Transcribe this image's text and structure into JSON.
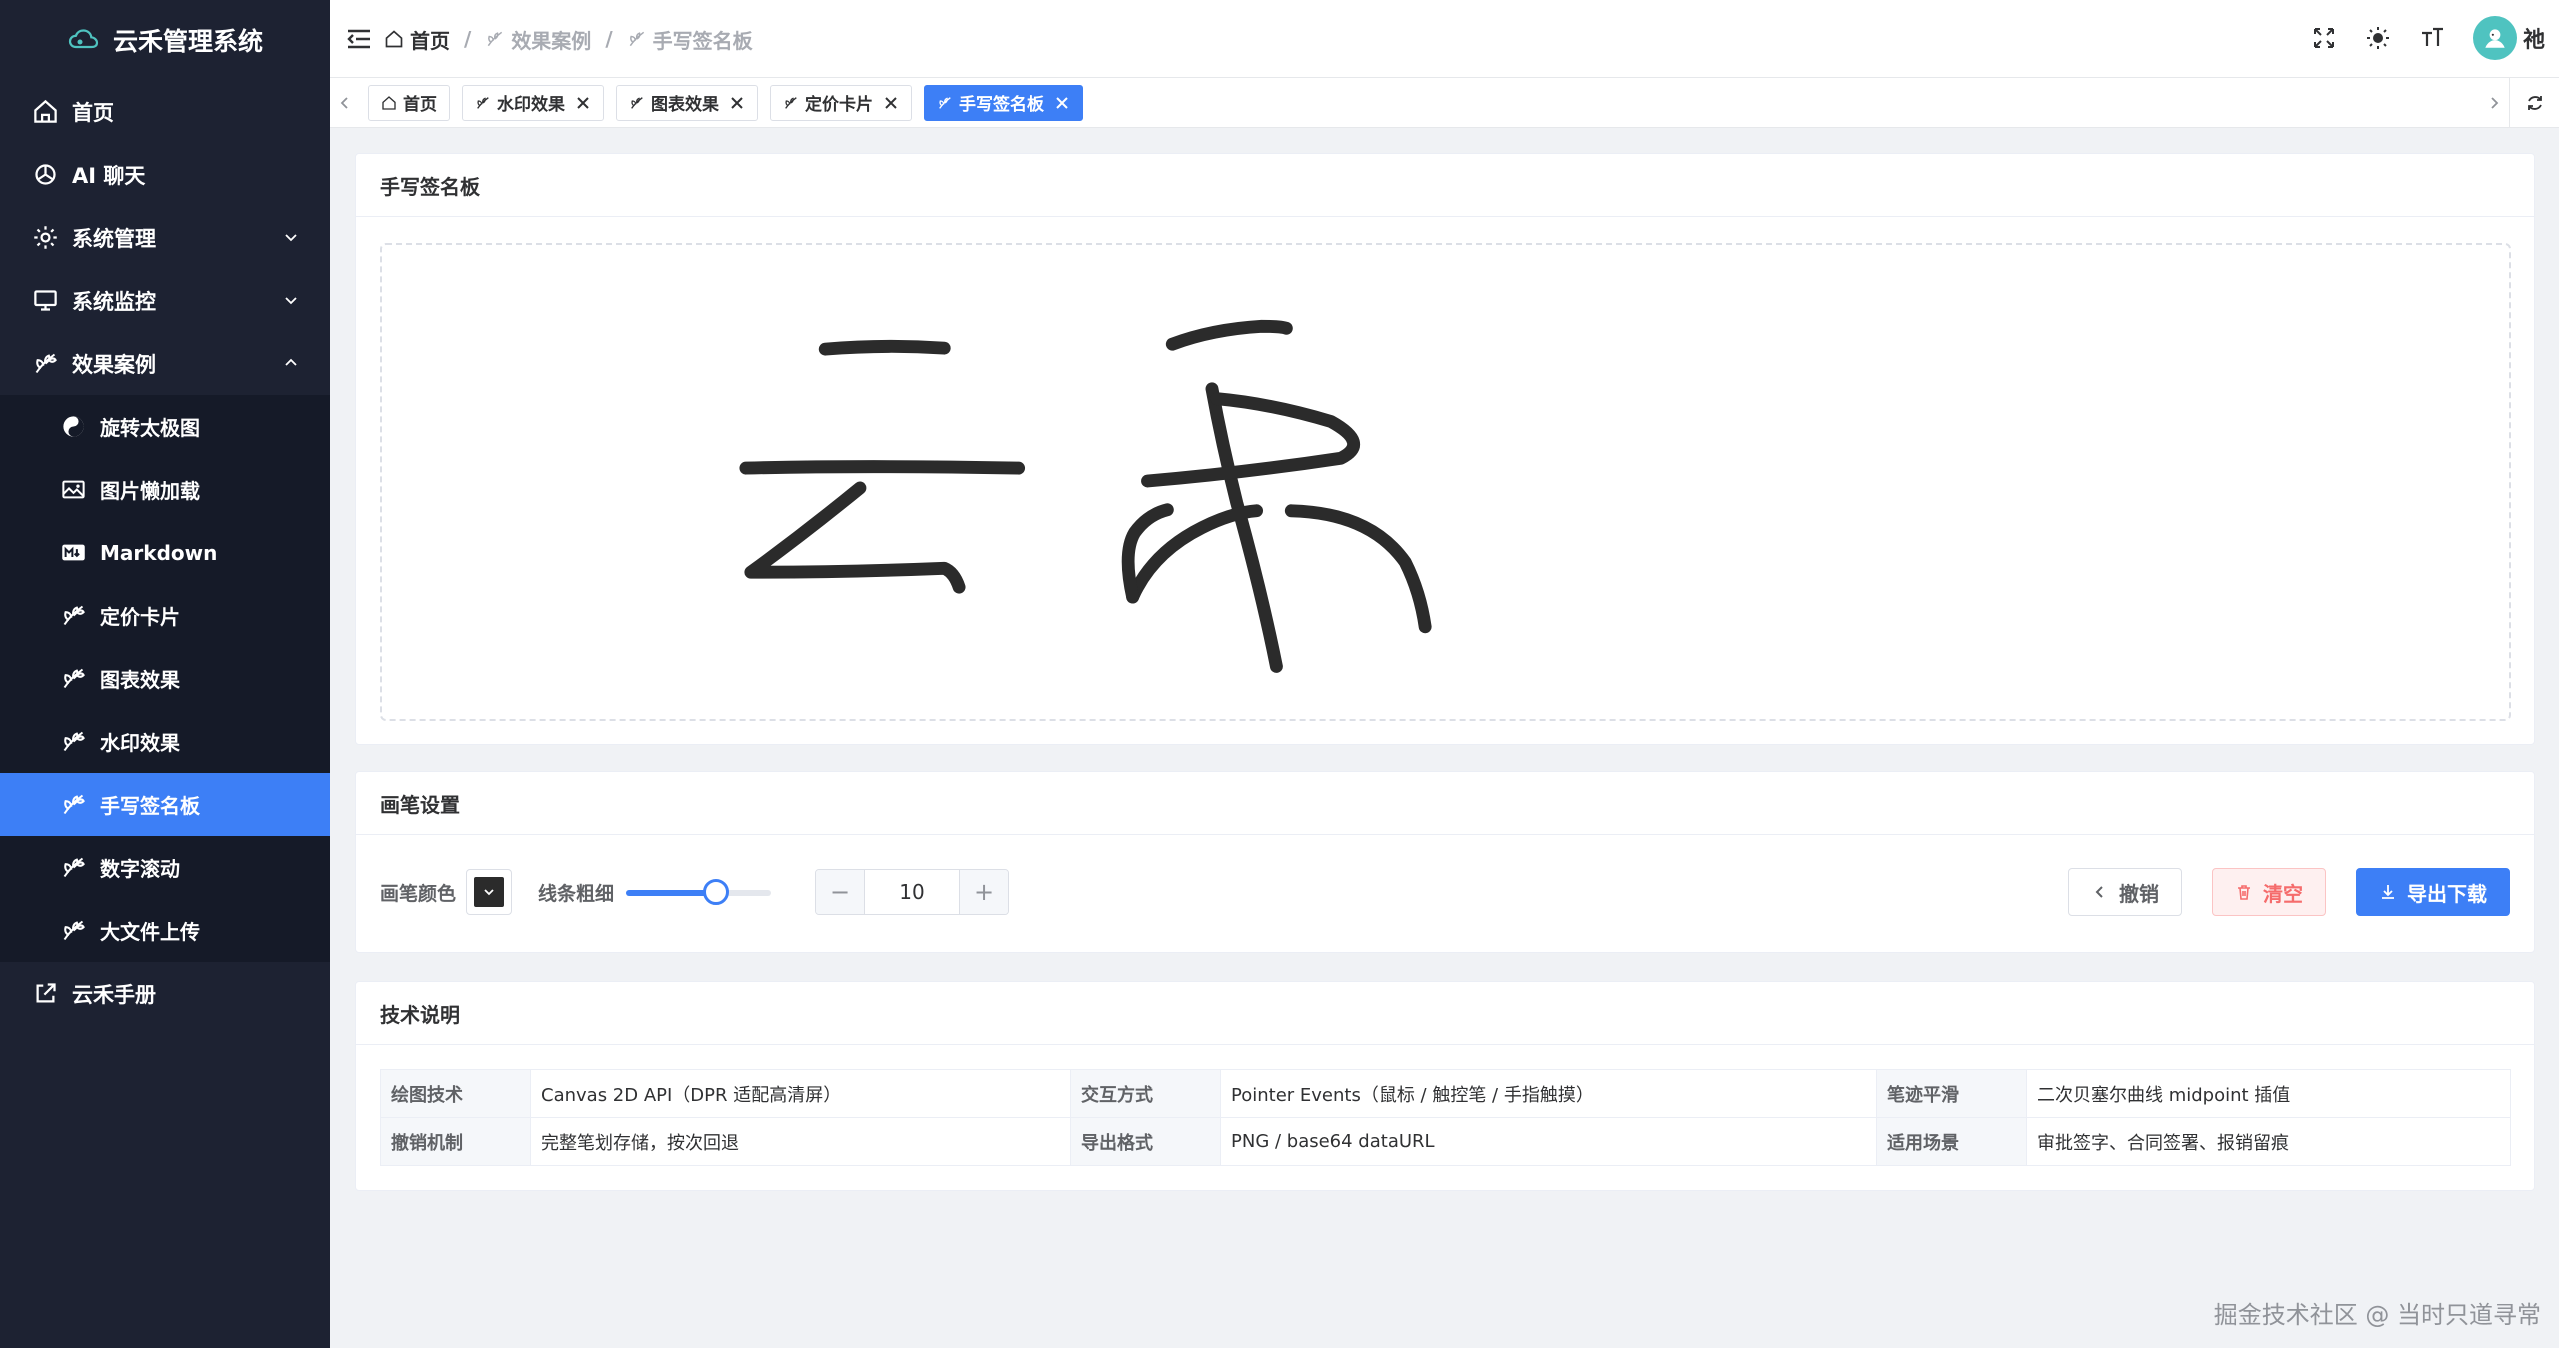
{
  "app": {
    "title": "云禾管理系统"
  },
  "sidebar": {
    "items": [
      {
        "label": "首页"
      },
      {
        "label": "AI 聊天"
      },
      {
        "label": "系统管理"
      },
      {
        "label": "系统监控"
      },
      {
        "label": "效果案例"
      }
    ],
    "sub_items": [
      {
        "label": "旋转太极图"
      },
      {
        "label": "图片懒加载"
      },
      {
        "label": "Markdown"
      },
      {
        "label": "定价卡片"
      },
      {
        "label": "图表效果"
      },
      {
        "label": "水印效果"
      },
      {
        "label": "手写签名板"
      },
      {
        "label": "数字滚动"
      },
      {
        "label": "大文件上传"
      }
    ],
    "manual": {
      "label": "云禾手册"
    }
  },
  "header": {
    "breadcrumb": [
      "首页",
      "效果案例",
      "手写签名板"
    ],
    "user_name": "祂"
  },
  "tabs": [
    "首页",
    "水印效果",
    "图表效果",
    "定价卡片",
    "手写签名板"
  ],
  "signature_card": {
    "title": "手写签名板"
  },
  "pen_card": {
    "title": "画笔设置",
    "color_label": "画笔颜色",
    "pen_color": "#2b2b2b",
    "width_label": "线条粗细",
    "width_value": "10",
    "slider_fraction": 0.62,
    "undo_label": "撤销",
    "clear_label": "清空",
    "export_label": "导出下载"
  },
  "tech_card": {
    "title": "技术说明",
    "rows": [
      [
        "绘图技术",
        "Canvas 2D API（DPR 适配高清屏）",
        "交互方式",
        "Pointer Events（鼠标 / 触控笔 / 手指触摸）",
        "笔迹平滑",
        "二次贝塞尔曲线 midpoint 插值"
      ],
      [
        "撤销机制",
        "完整笔划存储，按次回退",
        "导出格式",
        "PNG / base64 dataURL",
        "适用场景",
        "审批签字、合同签署、报销留痕"
      ]
    ]
  },
  "footer": {
    "watermark": "掘金技术社区 @ 当时只道寻常"
  },
  "colors": {
    "sidebar_bg": "#1d2232",
    "accent": "#3d7ff6",
    "danger": "#f56c6c"
  }
}
